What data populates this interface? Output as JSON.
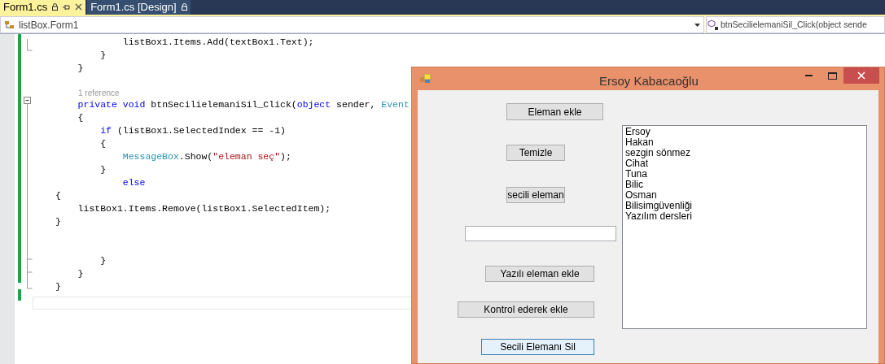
{
  "tabs": [
    {
      "label": "Form1.cs",
      "selected": true,
      "pinned": true
    },
    {
      "label": "Form1.cs [Design]",
      "selected": false,
      "pinned": false
    }
  ],
  "nav": {
    "left": "listBox.Form1",
    "right": "btnSecilielemaniSil_Click(object sende"
  },
  "code_lines": [
    {
      "kind": "code",
      "tokens": [
        {
          "kind": "plain",
          "text": "            listBox1.Items.Add(textBox1.Text);"
        }
      ]
    },
    {
      "kind": "code",
      "tokens": [
        {
          "kind": "plain",
          "text": "        }"
        }
      ]
    },
    {
      "kind": "code",
      "tokens": [
        {
          "kind": "plain",
          "text": "    }"
        }
      ]
    },
    {
      "kind": "blank"
    },
    {
      "kind": "lens",
      "text": "1 reference"
    },
    {
      "kind": "code",
      "tokens": [
        {
          "kind": "keyword",
          "text": "    private void"
        },
        {
          "kind": "plain",
          "text": " btnSecilielemaniSil_Click("
        },
        {
          "kind": "keyword",
          "text": "object"
        },
        {
          "kind": "plain",
          "text": " sender, "
        },
        {
          "kind": "type",
          "text": "Event"
        }
      ]
    },
    {
      "kind": "code",
      "tokens": [
        {
          "kind": "plain",
          "text": "    {"
        }
      ]
    },
    {
      "kind": "code",
      "tokens": [
        {
          "kind": "keyword",
          "text": "        if"
        },
        {
          "kind": "plain",
          "text": " (listBox1.SelectedIndex == -1)"
        }
      ]
    },
    {
      "kind": "code",
      "tokens": [
        {
          "kind": "plain",
          "text": "        {"
        }
      ]
    },
    {
      "kind": "code",
      "tokens": [
        {
          "kind": "type",
          "text": "            MessageBox"
        },
        {
          "kind": "plain",
          "text": ".Show("
        },
        {
          "kind": "string",
          "text": "\"eleman seç\""
        },
        {
          "kind": "plain",
          "text": ");"
        }
      ]
    },
    {
      "kind": "code",
      "tokens": [
        {
          "kind": "plain",
          "text": "        }"
        }
      ]
    },
    {
      "kind": "code",
      "tokens": [
        {
          "kind": "keyword",
          "text": "            else"
        }
      ]
    },
    {
      "kind": "code",
      "tokens": [
        {
          "kind": "plain",
          "text": "{"
        }
      ]
    },
    {
      "kind": "code",
      "tokens": [
        {
          "kind": "plain",
          "text": "    listBox1.Items.Remove(listBox1.SelectedItem);"
        }
      ]
    },
    {
      "kind": "code",
      "tokens": [
        {
          "kind": "plain",
          "text": "}"
        }
      ]
    },
    {
      "kind": "blank"
    },
    {
      "kind": "blank"
    },
    {
      "kind": "code",
      "tokens": [
        {
          "kind": "plain",
          "text": "        }"
        }
      ]
    },
    {
      "kind": "code",
      "tokens": [
        {
          "kind": "plain",
          "text": "    }"
        }
      ]
    },
    {
      "kind": "code",
      "tokens": [
        {
          "kind": "plain",
          "text": "}"
        }
      ]
    }
  ],
  "form": {
    "title": "Ersoy Kabacaoğlu",
    "buttons": [
      {
        "label": "Eleman ekle",
        "focused": false
      },
      {
        "label": "Temizle",
        "focused": false
      },
      {
        "label": "secili eleman",
        "focused": false
      },
      {
        "label": "Yazılı eleman ekle",
        "focused": false
      },
      {
        "label": "Kontrol ederek ekle",
        "focused": false
      },
      {
        "label": "Secili Elemanı Sil",
        "focused": true
      }
    ],
    "list_items": [
      "Ersoy",
      "Hakan",
      "sezgin sönmez",
      "Cihat",
      "Tuna",
      "Bilic",
      "Osman",
      "Bilisimgüvenliği",
      "Yazılım dersleri"
    ]
  }
}
